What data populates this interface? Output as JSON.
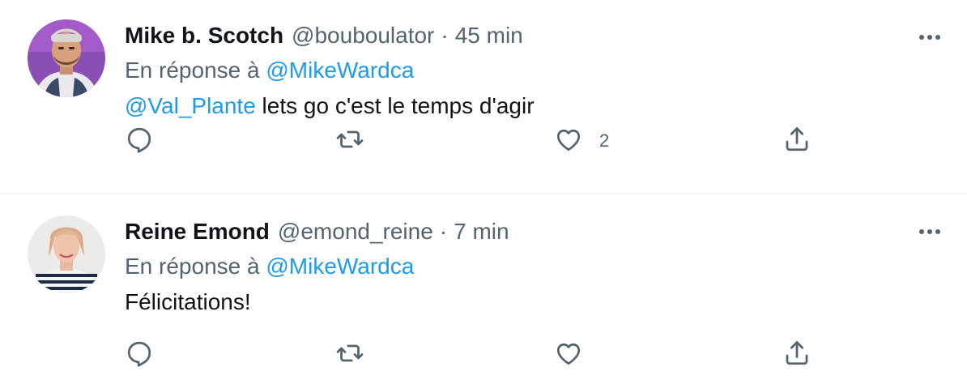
{
  "tweets": [
    {
      "author_name": "Mike b. Scotch",
      "author_handle": "@bouboulator",
      "separator": "·",
      "time": "45 min",
      "reply_prefix": "En réponse à",
      "reply_to": "@MikeWardca",
      "text_mention": "@Val_Plante",
      "text": " lets go c'est le temps d'agir",
      "like_count": "2",
      "icons": [
        "more-icon",
        "reply-icon",
        "retweet-icon",
        "like-icon",
        "share-icon"
      ]
    },
    {
      "author_name": "Reine Emond",
      "author_handle": "@emond_reine",
      "separator": "·",
      "time": "7 min",
      "reply_prefix": "En réponse à",
      "reply_to": "@MikeWardca",
      "text_mention": "",
      "text": "Félicitations!",
      "like_count": "",
      "icons": [
        "more-icon",
        "reply-icon",
        "retweet-icon",
        "like-icon",
        "share-icon"
      ]
    }
  ],
  "colors": {
    "accent": "#1d9bf0",
    "secondary_text": "#536471",
    "primary_text": "#0f1419",
    "divider": "#eff3f4"
  }
}
